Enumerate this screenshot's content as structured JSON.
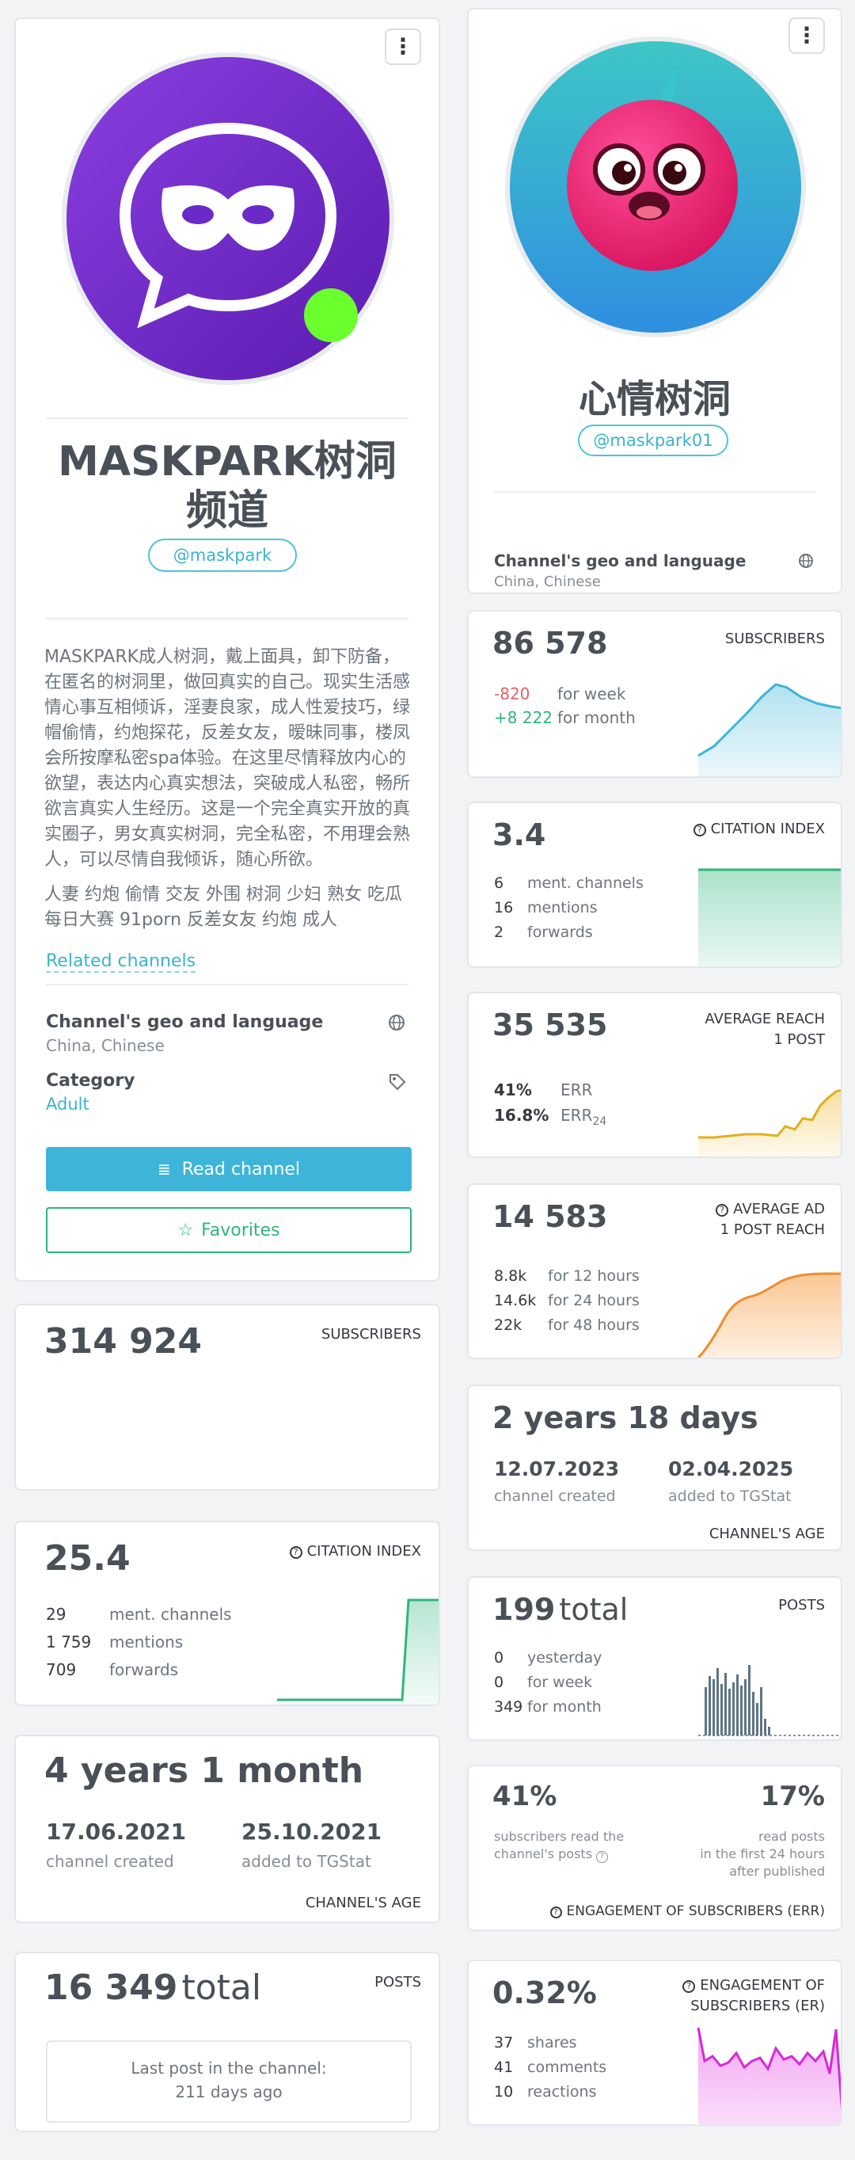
{
  "left": {
    "profile": {
      "title_line1": "MASKPARK树洞",
      "title_line2": "频道",
      "handle": "@maskpark",
      "description": "MASKPARK成人树洞，戴上面具，卸下防备，在匿名的树洞里，做回真实的自己。现实生活感情心事互相倾诉，淫妻良家，成人性爱技巧，绿帽偷情，约炮探花，反差女友，暧昧同事，楼凤会所按摩私密spa体验。在这里尽情释放内心的欲望，表达内心真实想法，突破成人私密，畅所欲言真实人生经历。这是一个完全真实开放的真实圈子，男女真实树洞，完全私密，不用理会熟人，可以尽情自我倾诉，随心所欲。",
      "tags": "人妻 约炮 偷情 交友 外围 树洞 少妇 熟女 吃瓜 每日大赛 91porn 反差女友 约炮 成人",
      "related_link": "Related channels",
      "geo_label": "Channel's geo and language",
      "geo_value": "China, Chinese",
      "category_label": "Category",
      "category_value": "Adult",
      "read_button": "Read channel",
      "favorites_button": "Favorites"
    },
    "subscribers": {
      "value": "314 924",
      "label": "SUBSCRIBERS"
    },
    "citation": {
      "value": "25.4",
      "label": "CITATION INDEX",
      "rows": [
        {
          "v": "29",
          "d": "ment. channels"
        },
        {
          "v": "1 759",
          "d": "mentions"
        },
        {
          "v": "709",
          "d": "forwards"
        }
      ]
    },
    "age": {
      "value": "4 years 1 month",
      "created_date": "17.06.2021",
      "created_label": "channel created",
      "added_date": "25.10.2021",
      "added_label": "added to TGStat",
      "label": "CHANNEL'S AGE"
    },
    "posts": {
      "value": "16 349",
      "suffix": "total",
      "label": "POSTS",
      "last_post_line1": "Last post in the channel:",
      "last_post_line2": "211 days ago"
    }
  },
  "right": {
    "profile": {
      "title": "心情树洞",
      "handle": "@maskpark01",
      "geo_label": "Channel's geo and language",
      "geo_value": "China, Chinese"
    },
    "subscribers": {
      "value": "86 578",
      "label": "SUBSCRIBERS",
      "week_value": "-820",
      "week_label": "for week",
      "month_value": "+8 222",
      "month_label": "for month"
    },
    "citation": {
      "value": "3.4",
      "label": "CITATION INDEX",
      "rows": [
        {
          "v": "6",
          "d": "ment. channels"
        },
        {
          "v": "16",
          "d": "mentions"
        },
        {
          "v": "2",
          "d": "forwards"
        }
      ]
    },
    "reach": {
      "value": "35 535",
      "label_line1": "AVERAGE REACH",
      "label_line2": "1 POST",
      "err_value": "41%",
      "err_label": "ERR",
      "err24_value": "16.8%",
      "err24_label": "ERR",
      "err24_sub": "24"
    },
    "ad_reach": {
      "value": "14 583",
      "label_line1": "AVERAGE AD",
      "label_line2": "1 POST REACH",
      "rows": [
        {
          "v": "8.8k",
          "d": "for 12 hours"
        },
        {
          "v": "14.6k",
          "d": "for 24 hours"
        },
        {
          "v": "22k",
          "d": "for 48 hours"
        }
      ]
    },
    "age": {
      "value": "2 years 18 days",
      "created_date": "12.07.2023",
      "created_label": "channel created",
      "added_date": "02.04.2025",
      "added_label": "added to TGStat",
      "label": "CHANNEL'S AGE"
    },
    "posts": {
      "value": "199",
      "suffix": "total",
      "label": "POSTS",
      "rows": [
        {
          "v": "0",
          "d": "yesterday"
        },
        {
          "v": "0",
          "d": "for week"
        },
        {
          "v": "349",
          "d": "for month"
        }
      ]
    },
    "err": {
      "left_value": "41%",
      "left_line1": "subscribers read the",
      "left_line2": "channel's posts",
      "right_value": "17%",
      "right_line1": "read posts",
      "right_line2": "in the first 24 hours",
      "right_line3": "after published",
      "label": "ENGAGEMENT OF SUBSCRIBERS (ERR)"
    },
    "er": {
      "value": "0.32%",
      "label_line1": "ENGAGEMENT OF",
      "label_line2": "SUBSCRIBERS (ER)",
      "rows": [
        {
          "v": "37",
          "d": "shares"
        },
        {
          "v": "41",
          "d": "comments"
        },
        {
          "v": "10",
          "d": "reactions"
        }
      ]
    }
  },
  "colors": {
    "accent": "#3eb5d8",
    "green": "#2eb67d",
    "red": "#e4606d",
    "orange": "#f08c2e",
    "yellow": "#e0b020",
    "magenta": "#d62ad6"
  }
}
